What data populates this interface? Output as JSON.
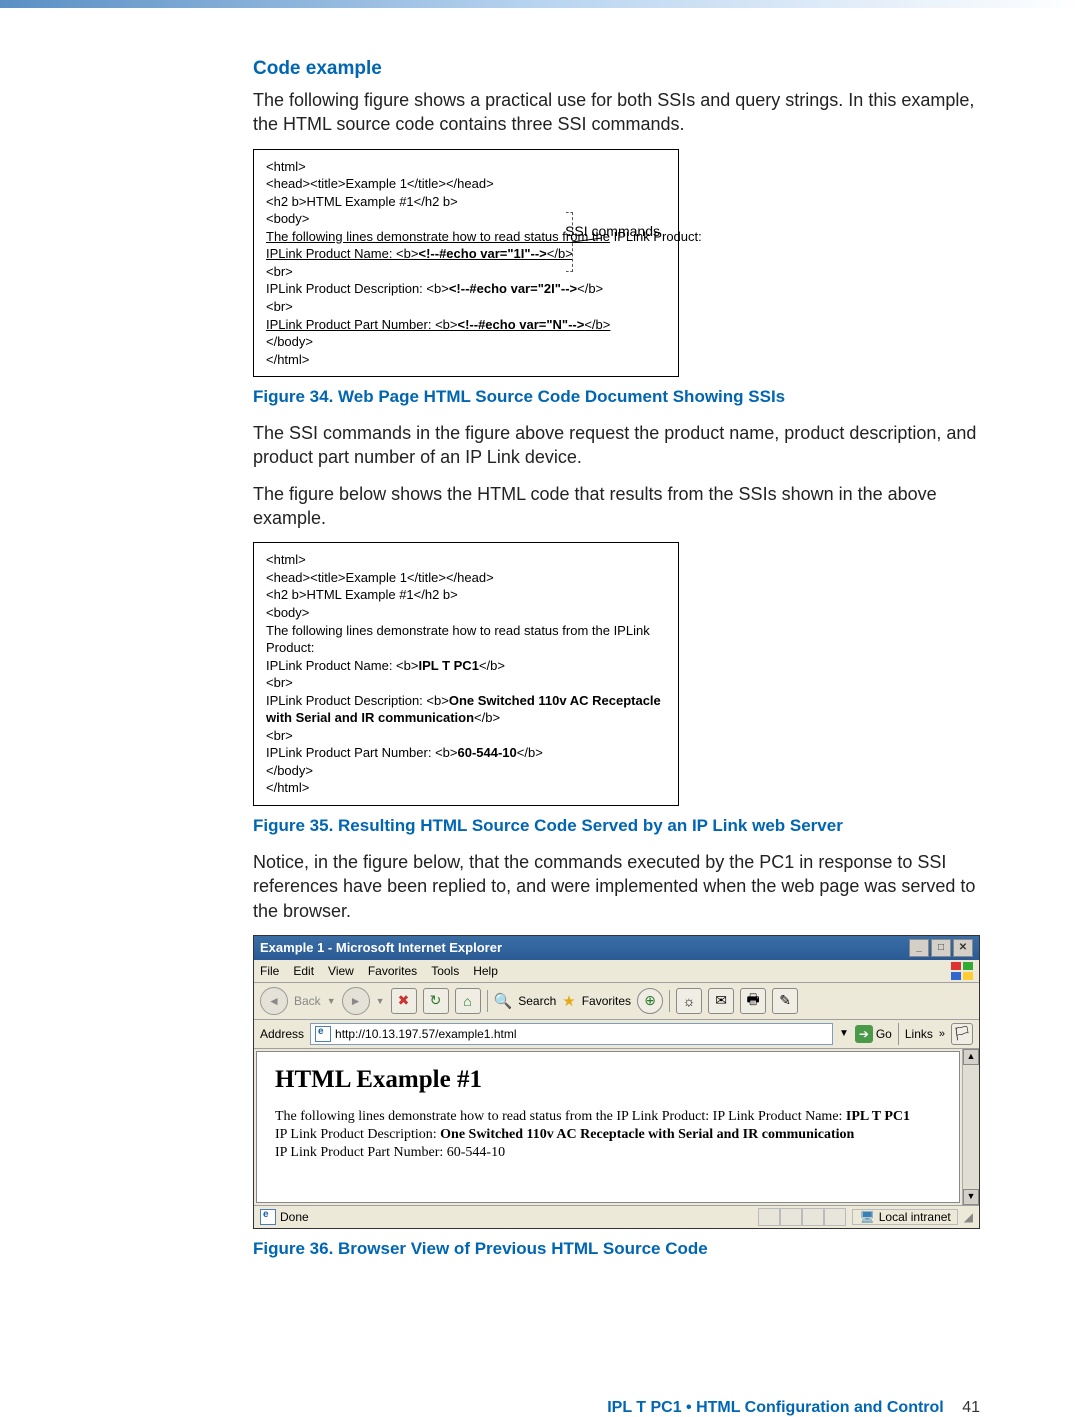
{
  "heading": "Code example",
  "intro": "The following figure shows a practical use for both SSIs and query strings. In this example, the HTML source code contains three SSI commands.",
  "fig34": {
    "label": "SSI commands",
    "lines": {
      "l1": "<html>",
      "l2": "<head><title>Example 1</title></head>",
      "l3": "<h2 b>HTML Example #1</h2 b>",
      "l4": "<body>",
      "l5a": "The following lines demonstrate how to read status from the",
      "l5b": " IPLink Product:",
      "l6a": "IPLink Product Name: <b>",
      "l6b": "<!--#echo var=\"1I\"-->",
      "l6c": "</b>",
      "l7": "<br>",
      "l8a": "IPLink Product Description: <b>",
      "l8b": "<!--#echo var=\"2I\"-->",
      "l8c": "</b>",
      "l9": "<br>",
      "l10a": "IPLink Product Part Number: <b>",
      "l10b": "<!--#echo var=\"N\"-->",
      "l10c": "</b>",
      "l11": "</body>",
      "l12": "</html>"
    },
    "caption": "Figure 34. Web Page HTML Source Code Document Showing SSIs"
  },
  "para2": "The SSI commands in the figure above request the product name, product description, and product part number of an IP Link device.",
  "para3": "The figure below shows the HTML code that results from the SSIs shown in the above example.",
  "fig35": {
    "lines": {
      "l1": "<html>",
      "l2": "<head><title>Example 1</title></head>",
      "l3": "<h2 b>HTML Example #1</h2 b>",
      "l4": "<body>",
      "l5": "The following lines demonstrate how to read status from the IPLink Product:",
      "l6a": "IPLink Product Name: <b>",
      "l6b": "IPL T PC1",
      "l6c": "</b>",
      "l7": "<br>",
      "l8a": "IPLink Product Description: <b>",
      "l8b": "One Switched 110v AC Receptacle with Serial and IR communication",
      "l8c": "</b>",
      "l9": "<br>",
      "l10a": "IPLink Product Part Number: <b>",
      "l10b": "60-544-10",
      "l10c": "</b>",
      "l11": "</body>",
      "l12": "</html>"
    },
    "caption": "Figure 35. Resulting HTML Source Code Served by an IP Link web Server"
  },
  "para4": "Notice, in the figure below, that the commands executed by the PC1 in response to SSI references have been replied to, and were implemented when the web page was served to the browser.",
  "browser": {
    "title": "Example 1 - Microsoft Internet Explorer",
    "menus": [
      "File",
      "Edit",
      "View",
      "Favorites",
      "Tools",
      "Help"
    ],
    "back": "Back",
    "search": "Search",
    "favorites": "Favorites",
    "addressLabel": "Address",
    "url": "http://10.13.197.57/example1.html",
    "go": "Go",
    "links": "Links",
    "pageHeading": "HTML Example #1",
    "pageBody1": "The following lines demonstrate how to read status from the IP Link Product: IP Link Product Name: ",
    "pageBody1b": "IPL T PC1",
    "pageBody2a": "IP Link Product Description: ",
    "pageBody2b": "One Switched 110v AC Receptacle with Serial and IR communication",
    "pageBody3": "IP Link Product Part Number: 60-544-10",
    "statusDone": "Done",
    "statusZone": "Local intranet"
  },
  "fig36caption": "Figure 36. Browser View of Previous HTML Source Code",
  "footer": {
    "text": "IPL T PC1 • HTML Configuration and Control",
    "page": "41"
  }
}
